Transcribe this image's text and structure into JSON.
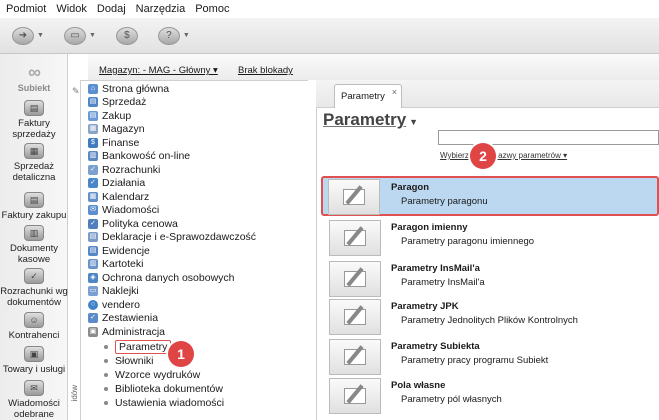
{
  "menu": [
    "Podmiot",
    "Widok",
    "Dodaj",
    "Narzędzia",
    "Pomoc"
  ],
  "rail": {
    "logo": "Subiekt",
    "items": [
      "Faktury sprzedaży",
      "Sprzedaż detaliczna",
      "Faktury zakupu",
      "Dokumenty kasowe",
      "Rozrachunki wg dokumentów",
      "Kontrahenci",
      "Towary i usługi",
      "Wiadomości odebrane"
    ]
  },
  "header": {
    "magazyn": "Magazyn: - MAG - Główny ▾",
    "blokady": "Brak blokady"
  },
  "tree": {
    "nodes": [
      "Strona główna",
      "Sprzedaż",
      "Zakup",
      "Magazyn",
      "Finanse",
      "Bankowość on-line",
      "Rozrachunki",
      "Działania",
      "Kalendarz",
      "Wiadomości",
      "Polityka cenowa",
      "Deklaracje i e-Sprawozdawczość",
      "Ewidencje",
      "Kartoteki",
      "Ochrona danych osobowych",
      "Naklejki",
      "vendero",
      "Zestawienia",
      "Administracja"
    ],
    "sub": [
      "Parametry",
      "Słowniki",
      "Wzorce wydruków",
      "Biblioteka dokumentów",
      "Ustawienia wiadomości"
    ],
    "side_tab": "idów"
  },
  "tab": {
    "label": "Parametry",
    "close": "×"
  },
  "page": {
    "title": "Parametry",
    "filter_label": "Wybierz grupę nazwy parametrów ▾"
  },
  "list": [
    {
      "title": "Paragon",
      "desc": "Parametry paragonu"
    },
    {
      "title": "Paragon imienny",
      "desc": "Parametry paragonu imiennego"
    },
    {
      "title": "Parametry InsMail'a",
      "desc": "Parametry InsMail'a"
    },
    {
      "title": "Parametry JPK",
      "desc": "Parametry Jednolitych Plików Kontrolnych"
    },
    {
      "title": "Parametry Subiekta",
      "desc": "Parametry pracy programu Subiekt"
    },
    {
      "title": "Pola własne",
      "desc": "Parametry pól własnych"
    }
  ],
  "badges": [
    "1",
    "2"
  ],
  "colors": {
    "selection": "#bcd8f0",
    "highlight": "#e05050",
    "badge": "#e04545"
  }
}
